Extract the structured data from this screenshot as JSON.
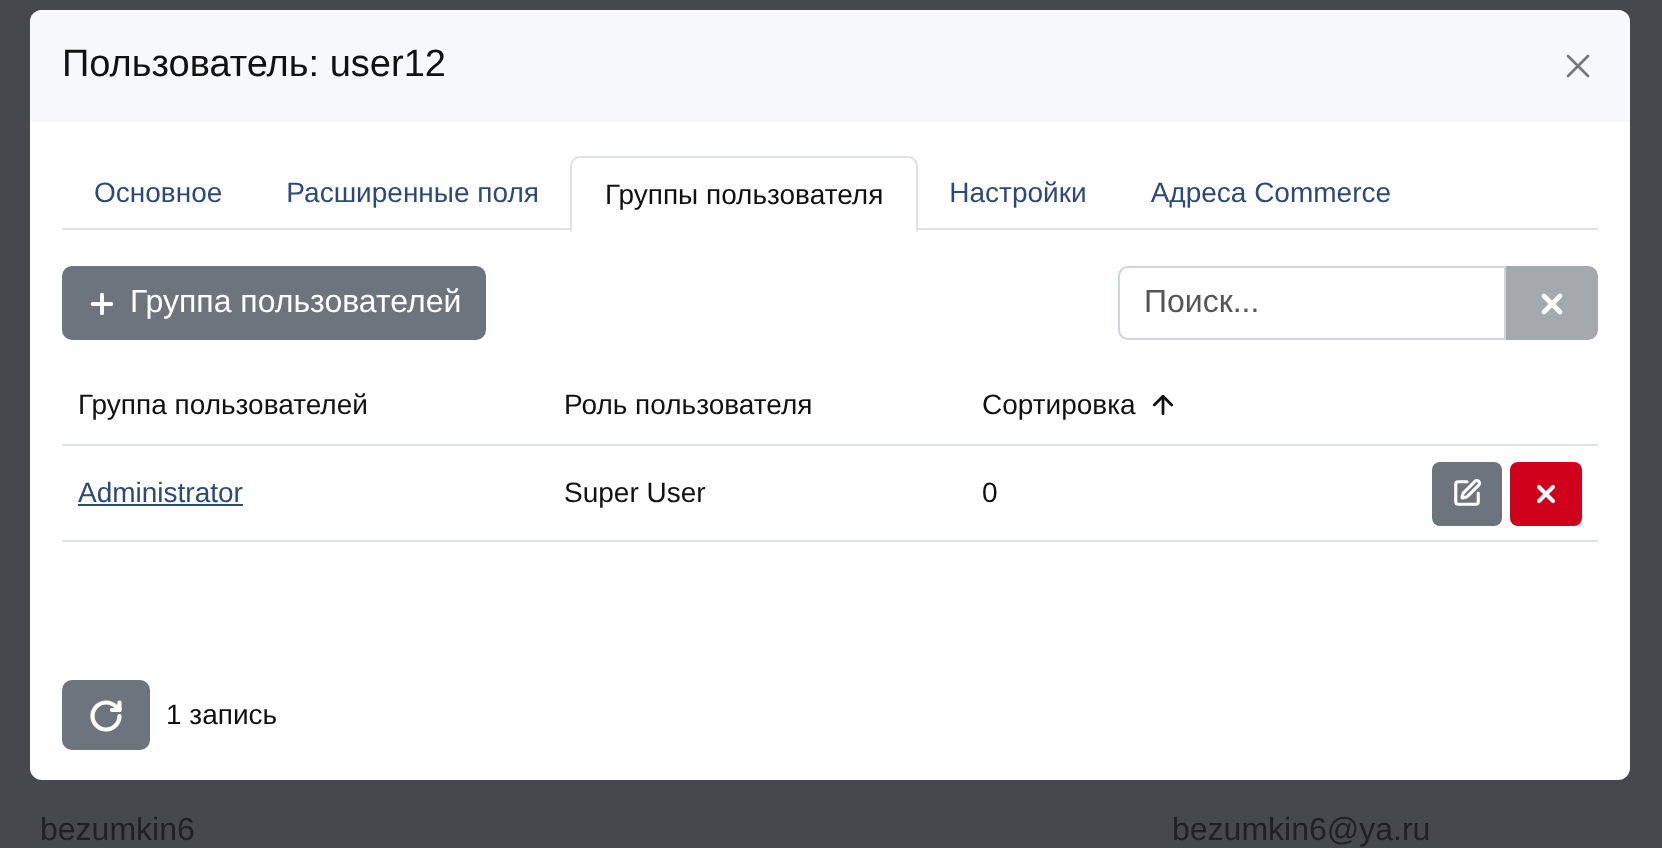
{
  "background_rows": [
    {
      "login": "bezumkin6",
      "email": "bezumkin6@ya.ru"
    }
  ],
  "modal": {
    "title": "Пользователь: user12"
  },
  "tabs": [
    {
      "label": "Основное",
      "selected": false
    },
    {
      "label": "Расширенные поля",
      "selected": false
    },
    {
      "label": "Группы пользователя",
      "selected": true
    },
    {
      "label": "Настройки",
      "selected": false
    },
    {
      "label": "Адреса Commerce",
      "selected": false
    }
  ],
  "toolbar": {
    "add_button": "Группа пользователей",
    "search": {
      "placeholder": "Поиск..."
    }
  },
  "table": {
    "columns": [
      {
        "label": "Группа пользователей",
        "sorted": false
      },
      {
        "label": "Роль пользователя",
        "sorted": false
      },
      {
        "label": "Сортировка",
        "sorted": true
      }
    ],
    "rows": [
      {
        "group": "Administrator",
        "role": "Super User",
        "sort_order": "0"
      }
    ]
  },
  "footer": {
    "count": "1 запись"
  }
}
